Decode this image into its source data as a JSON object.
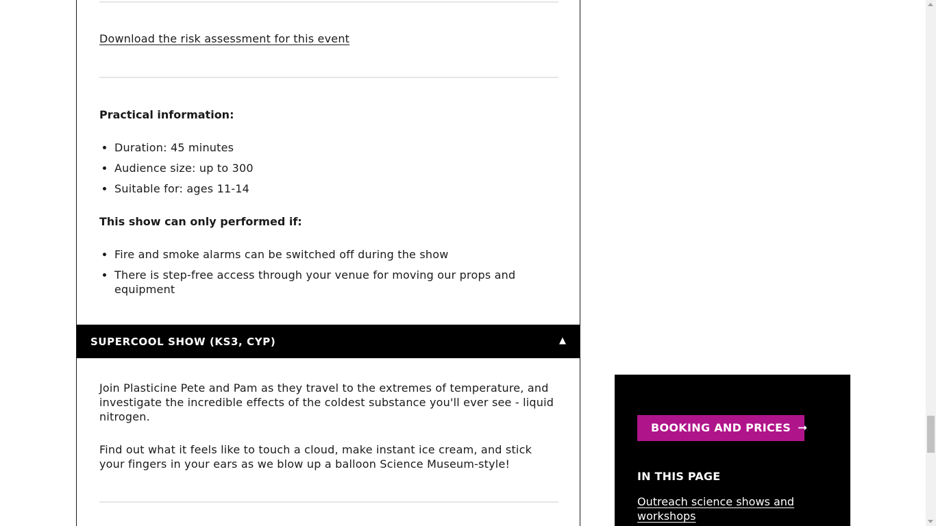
{
  "content": {
    "risk_assessment_link": "Download the risk assessment for this event",
    "practical_heading": "Practical information:",
    "practical_items": [
      "Duration: 45 minutes",
      "Audience size: up to 300",
      "Suitable for: ages 11-14"
    ],
    "conditions_heading": "This show can only performed if:",
    "conditions_items": [
      "Fire and smoke alarms can be switched off during the show",
      "There is step-free access through your venue for moving our props and equipment"
    ],
    "accordion": {
      "title": "SUPERCOOL SHOW (KS3, CYP)",
      "toggle_symbol": "▲",
      "paragraphs": [
        "Join Plasticine Pete and Pam as they travel to the extremes of temperature, and investigate the incredible effects of the coldest substance you'll ever see - liquid nitrogen.",
        "Find out what it feels like to touch a cloud, make instant ice cream, and stick your fingers in your ears as we blow up a balloon Science Museum-style!"
      ]
    }
  },
  "sidebar": {
    "booking_button_label": "BOOKING AND PRICES",
    "in_this_page_heading": "IN THIS PAGE",
    "in_this_page_link": "Outreach science shows and workshops"
  },
  "colors": {
    "accent": "#b0148a",
    "dark": "#000000",
    "divider": "#e6e6e6"
  },
  "icons": {
    "booking_arrow": "arrow-right-icon",
    "accordion_toggle": "triangle-up-icon"
  }
}
